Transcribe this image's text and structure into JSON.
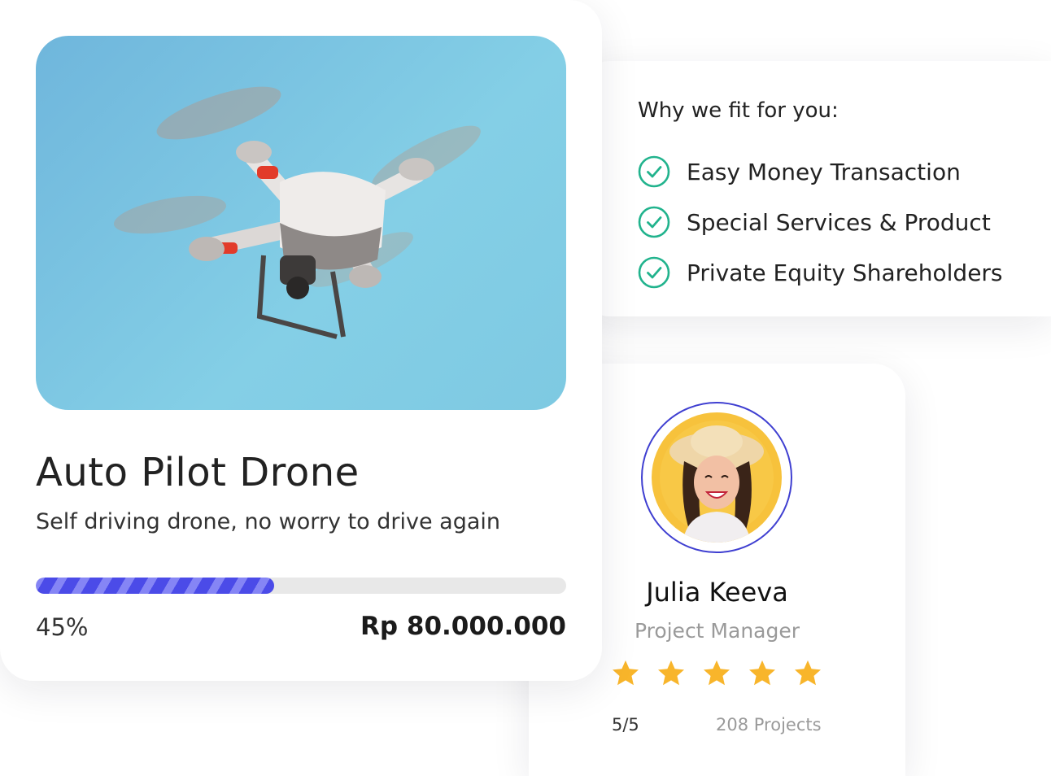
{
  "product": {
    "title": "Auto Pilot Drone",
    "subtitle": "Self driving drone, no worry to drive again",
    "progress_percent": 45,
    "progress_label": "45%",
    "price": "Rp 80.000.000",
    "image_icon": "drone-photo"
  },
  "why": {
    "title": "Why we fit for you:",
    "items": [
      {
        "label": "Easy Money Transaction",
        "icon": "check-circle-icon"
      },
      {
        "label": "Special Services & Product",
        "icon": "check-circle-icon"
      },
      {
        "label": "Private Equity Shareholders",
        "icon": "check-circle-icon"
      }
    ]
  },
  "profile": {
    "name": "Julia Keeva",
    "role": "Project Manager",
    "stars": 5,
    "rating": "5/5",
    "projects": "208 Projects"
  },
  "colors": {
    "accent": "#4b4be8",
    "check": "#21b38d",
    "star": "#f8b52b",
    "avatar_bg": "#f7c23c",
    "ring": "#3f3fd1",
    "sky": "#7ec9e2"
  }
}
